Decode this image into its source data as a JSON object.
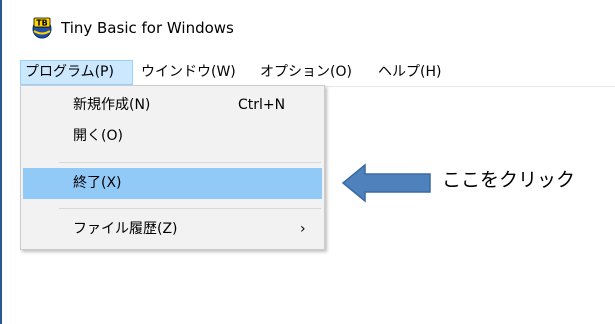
{
  "window": {
    "title": "Tiny Basic for Windows",
    "icon": "tiny-basic-app-icon"
  },
  "menubar": {
    "items": [
      {
        "label": "プログラム(P)",
        "active": true
      },
      {
        "label": "ウインドウ(W)",
        "active": false
      },
      {
        "label": "オプション(O)",
        "active": false
      },
      {
        "label": "ヘルプ(H)",
        "active": false
      }
    ]
  },
  "program_menu": {
    "items": [
      {
        "label": "新規作成(N)",
        "shortcut": "Ctrl+N"
      },
      {
        "label": "開く(O)",
        "shortcut": ""
      },
      {
        "label": "終了(X)",
        "shortcut": "",
        "highlighted": true
      },
      {
        "label": "ファイル履歴(Z)",
        "shortcut": "",
        "submenu_arrow": "›"
      }
    ]
  },
  "annotation": {
    "text": "ここをクリック",
    "arrow_color": "#4f81bd",
    "arrow_icon": "left-arrow-icon"
  },
  "colors": {
    "menu_active_bg": "#cce8ff",
    "menu_highlight_bg": "#91c9f7",
    "window_border": "#2b5797"
  }
}
